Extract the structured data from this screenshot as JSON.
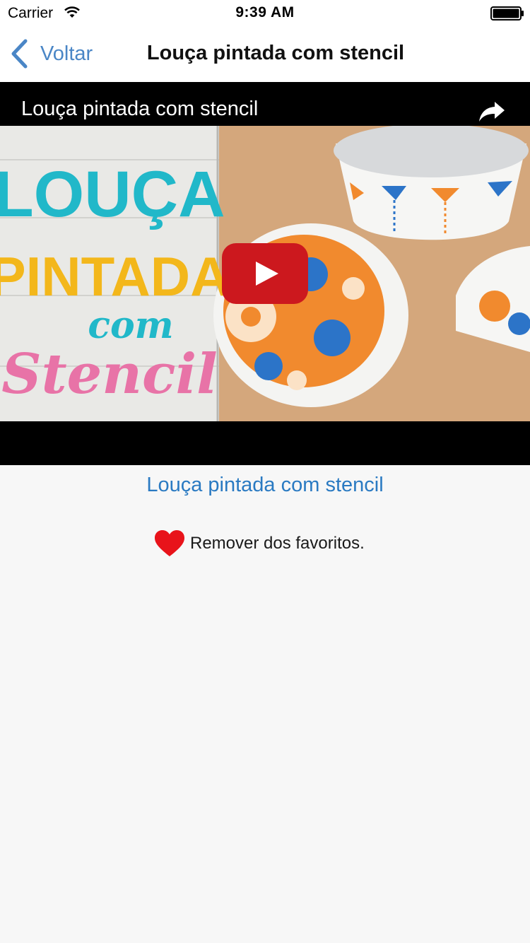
{
  "status_bar": {
    "carrier": "Carrier",
    "time": "9:39 AM",
    "icons": [
      "wifi-icon",
      "battery-icon"
    ]
  },
  "nav": {
    "back_label": "Voltar",
    "back_icon": "chevron-left-icon",
    "title": "Louça pintada com stencil"
  },
  "video": {
    "title": "Louça pintada com stencil",
    "share_icon": "share-icon",
    "play_icon": "youtube-play-icon",
    "thumbnail_text": {
      "line1": "LOUÇA",
      "line2": "PINTADA",
      "line3": "com",
      "line4": "Stencil"
    }
  },
  "content": {
    "link_text": "Louça pintada com stencil",
    "favorite_label": "Remover dos favoritos.",
    "favorite_icon": "heart-icon"
  },
  "colors": {
    "accent_blue": "#4a86c6",
    "link_blue": "#2a7ac2",
    "heart_red": "#e8131a",
    "youtube_red": "#cc181e"
  }
}
